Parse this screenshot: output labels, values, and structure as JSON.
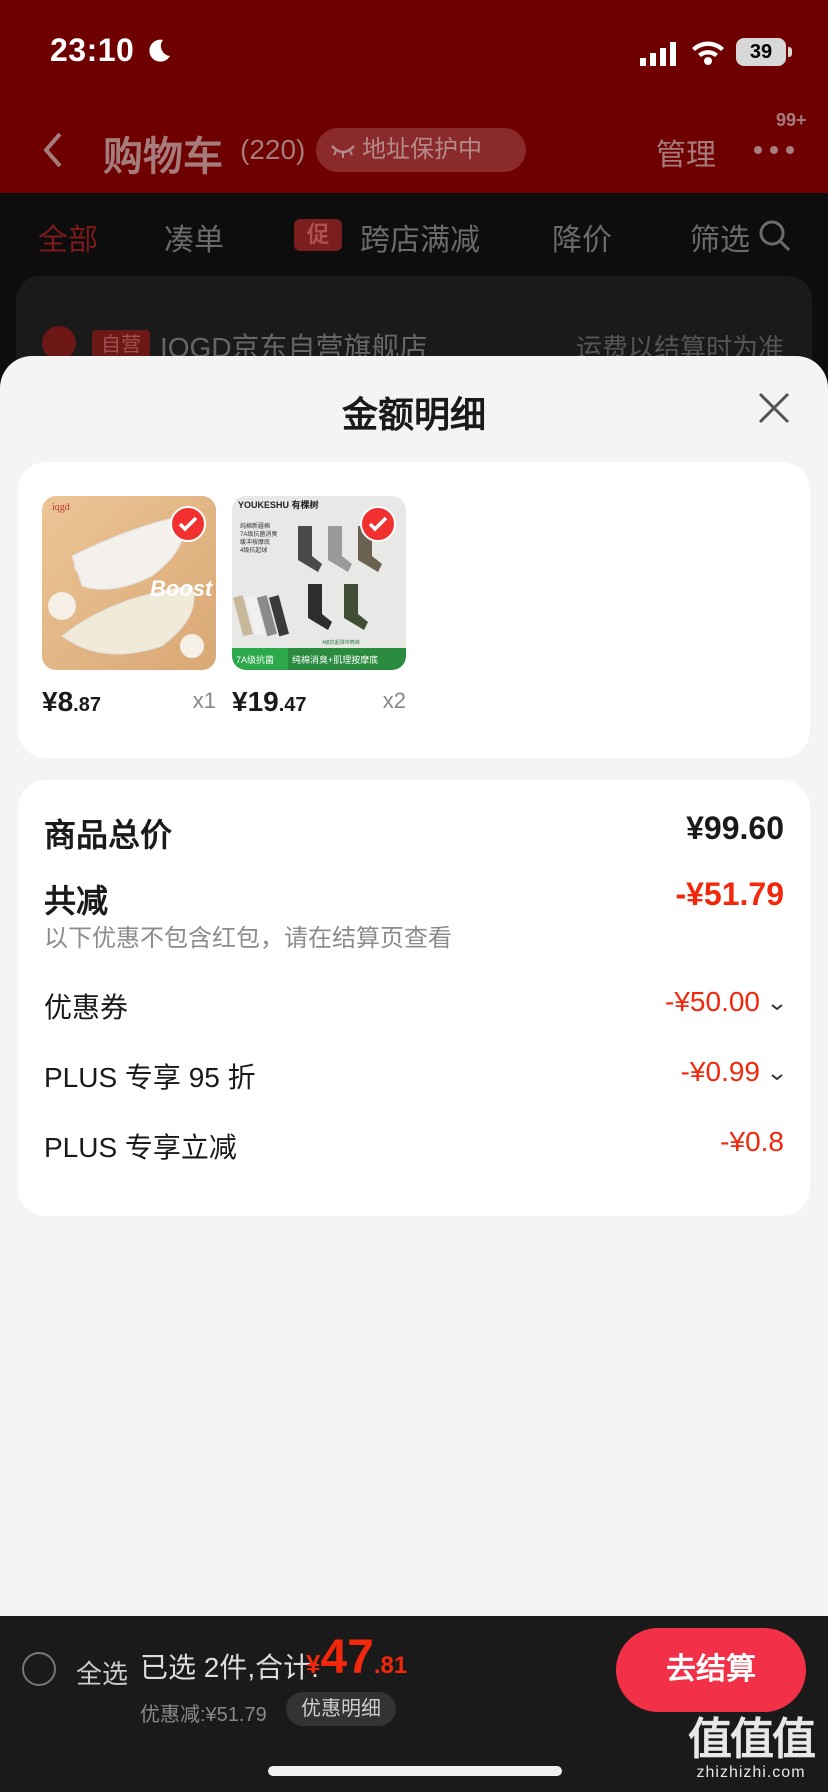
{
  "status_bar": {
    "time": "23:10",
    "battery": "39"
  },
  "nav": {
    "title": "购物车",
    "count": "(220)",
    "address_protect": "地址保护中",
    "manage": "管理",
    "more_badge": "99+"
  },
  "tabs": [
    {
      "label": "全部",
      "active": true
    },
    {
      "label": "凑单"
    },
    {
      "label": "跨店满减",
      "badge": "促"
    },
    {
      "label": "降价"
    },
    {
      "label": "筛选"
    }
  ],
  "store": {
    "tag": "自营",
    "name": "IQGD京东自营旗舰店",
    "shipping": "运费以结算时为准"
  },
  "sheet": {
    "title": "金额明细",
    "items": [
      {
        "price_int": "¥8",
        "price_dec": ".87",
        "qty": "x1",
        "image_text": "Boost",
        "brand": "iqgd"
      },
      {
        "price_int": "¥19",
        "price_dec": ".47",
        "qty": "x2",
        "brand": "YOUKESHU 有棵树",
        "features": [
          "纯棉新疆棉",
          "7A级抗菌消臭",
          "缓冲按摩底",
          "4级抗起球"
        ],
        "tag_left": "7A级抗菌",
        "tag_right": "纯棉消臭+肌理按摩底",
        "tag_small": "4级抗起球中筒袜"
      }
    ],
    "details": {
      "total_label": "商品总价",
      "total_value": "¥99.60",
      "reduce_label": "共减",
      "reduce_value": "-¥51.79",
      "note": "以下优惠不包含红包，请在结算页查看",
      "lines": [
        {
          "label": "优惠券",
          "value": "-¥50.00"
        },
        {
          "label": "PLUS 专享 95 折",
          "value": "-¥0.99"
        },
        {
          "label": "PLUS 专享立减",
          "value": "-¥0.8"
        }
      ]
    }
  },
  "bottom": {
    "select_all": "全选",
    "selected_text": "已选 2件,合计:",
    "total_cur": "¥",
    "total_int": "47",
    "total_dec": ".81",
    "discount_text": "优惠减:¥51.79",
    "discount_detail": "优惠明细",
    "checkout": "去结算"
  },
  "watermark": {
    "big": "值值值",
    "small": "zhizhizhi.com"
  },
  "colors": {
    "accent_red": "#f2270c",
    "checkout_red": "#f23048"
  }
}
